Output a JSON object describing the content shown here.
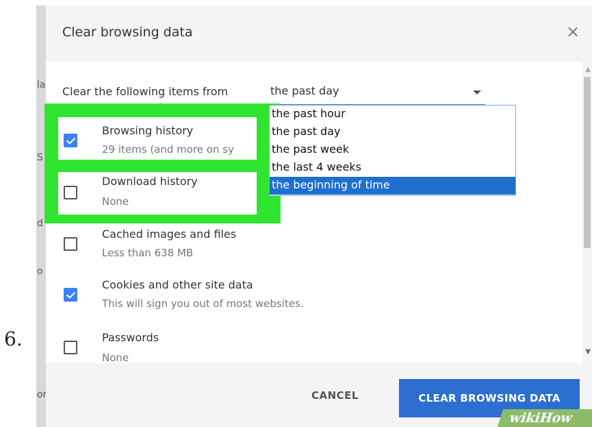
{
  "step_number": "6.",
  "background_fragments": [
    "la",
    "S",
    "d",
    "o",
    "or"
  ],
  "dialog": {
    "title": "Clear browsing data",
    "close_symbol": "×"
  },
  "time_range": {
    "label": "Clear the following items from",
    "selected_value": "the past day",
    "options": [
      "the past hour",
      "the past day",
      "the past week",
      "the last 4 weeks",
      "the beginning of time"
    ],
    "highlighted_option": "the beginning of time"
  },
  "items": [
    {
      "title": "Browsing history",
      "subtitle": "29 items (and more on sy",
      "checked": true
    },
    {
      "title": "Download history",
      "subtitle": "None",
      "checked": false
    },
    {
      "title": "Cached images and files",
      "subtitle": "Less than 638 MB",
      "checked": false
    },
    {
      "title": "Cookies and other site data",
      "subtitle": "This will sign you out of most websites.",
      "checked": true
    },
    {
      "title": "Passwords",
      "subtitle": "None",
      "checked": false
    }
  ],
  "buttons": {
    "cancel": "CANCEL",
    "clear": "CLEAR BROWSING DATA"
  },
  "watermark": "wikiHow",
  "colors": {
    "accent": "#2c6fd0",
    "highlight": "#2fe52f",
    "checkbox_checked": "#3b82f6",
    "selected_option": "#1e6fcf"
  }
}
